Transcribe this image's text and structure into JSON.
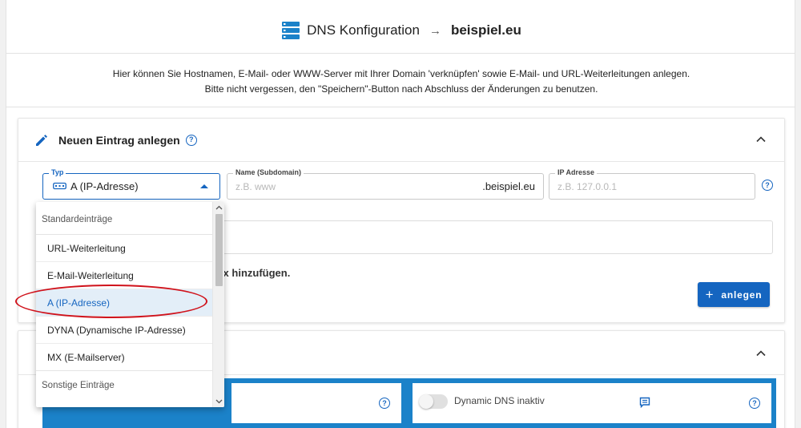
{
  "header": {
    "title": "DNS Konfiguration",
    "arrow": "→",
    "domain": "beispiel.eu"
  },
  "intro": {
    "line1": "Hier können Sie Hostnamen, E-Mail- oder WWW-Server mit Ihrer Domain 'verknüpfen' sowie E-Mail- und URL-Weiterleitungen anlegen.",
    "line2": "Bitte nicht vergessen, den \"Speichern\"-Button nach Abschluss der Änderungen zu benutzen."
  },
  "new_entry": {
    "title": "Neuen Eintrag anlegen",
    "typ_label": "Typ",
    "typ_value": "A (IP-Adresse)",
    "name_label": "Name (Subdomain)",
    "name_placeholder": "z.B. www",
    "name_suffix": ".beispiel.eu",
    "ip_label": "IP Adresse",
    "ip_placeholder": "z.B. 127.0.0.1",
    "partial_text": "ifix hinzufügen.",
    "add_label": "anlegen"
  },
  "dropdown": {
    "group1": "Standardeinträge",
    "items": [
      "URL-Weiterleitung",
      "E-Mail-Weiterleitung",
      "A (IP-Adresse)",
      "DYNA (Dynamische IP-Adresse)",
      "MX (E-Mailserver)"
    ],
    "selected_index": 2,
    "group2": "Sonstige Einträge"
  },
  "second_card": {
    "toggle_label": "Dynamic DNS inaktiv",
    "toggle_on": false
  },
  "colors": {
    "primary": "#1565c0",
    "band": "#1b82c9",
    "highlight_ring": "#d0121b"
  },
  "icons": {
    "header": "server-icon",
    "edit": "pencil-icon",
    "help": "help-circle-icon",
    "collapse": "chevron-up-icon",
    "typ": "dns-record-icon",
    "note": "note-icon"
  }
}
